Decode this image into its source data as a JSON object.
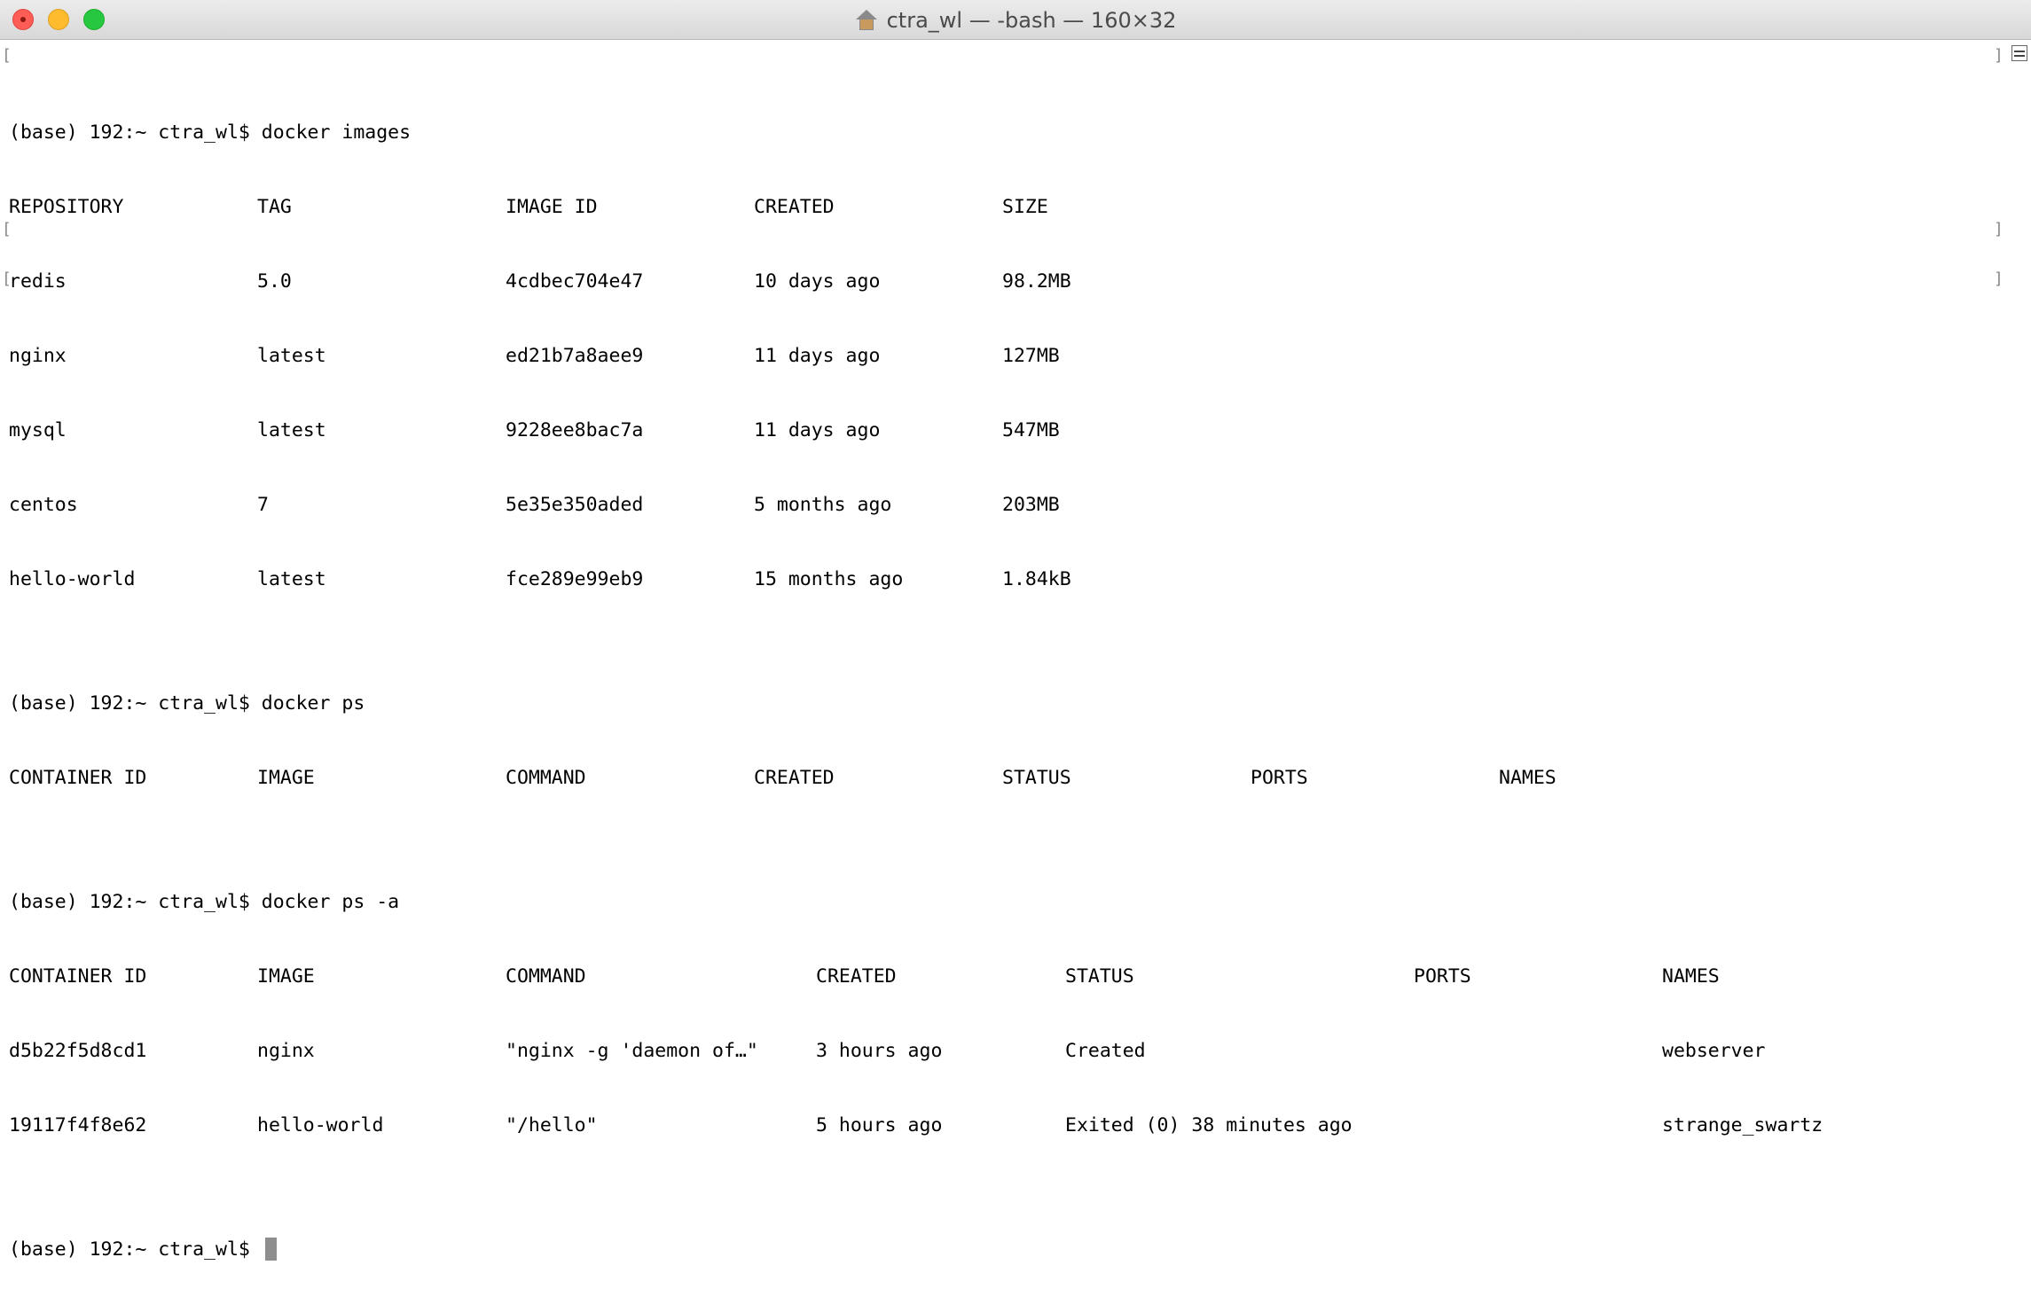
{
  "window": {
    "title": "ctra_wl — -bash — 160×32"
  },
  "terminal": {
    "prompt": "(base) 192:~ ctra_wl$ ",
    "commands": {
      "images": "docker images",
      "ps": "docker ps",
      "ps_a": "docker ps -a"
    },
    "images_table": {
      "headers": [
        "REPOSITORY",
        "TAG",
        "IMAGE ID",
        "CREATED",
        "SIZE"
      ],
      "rows": [
        [
          "redis",
          "5.0",
          "4cdbec704e47",
          "10 days ago",
          "98.2MB"
        ],
        [
          "nginx",
          "latest",
          "ed21b7a8aee9",
          "11 days ago",
          "127MB"
        ],
        [
          "mysql",
          "latest",
          "9228ee8bac7a",
          "11 days ago",
          "547MB"
        ],
        [
          "centos",
          "7",
          "5e35e350aded",
          "5 months ago",
          "203MB"
        ],
        [
          "hello-world",
          "latest",
          "fce289e99eb9",
          "15 months ago",
          "1.84kB"
        ]
      ]
    },
    "ps_table": {
      "headers": [
        "CONTAINER ID",
        "IMAGE",
        "COMMAND",
        "CREATED",
        "STATUS",
        "PORTS",
        "NAMES"
      ]
    },
    "ps_a_table": {
      "headers": [
        "CONTAINER ID",
        "IMAGE",
        "COMMAND",
        "CREATED",
        "STATUS",
        "PORTS",
        "NAMES"
      ],
      "rows": [
        [
          "d5b22f5d8cd1",
          "nginx",
          "\"nginx -g 'daemon of…\"",
          "3 hours ago",
          "Created",
          "",
          "webserver"
        ],
        [
          "19117f4f8e62",
          "hello-world",
          "\"/hello\"",
          "5 hours ago",
          "Exited (0) 38 minutes ago",
          "",
          "strange_swartz"
        ]
      ]
    }
  },
  "colors": {
    "close": "#fd5d55",
    "minimize": "#fdbb2d",
    "maximize": "#27c840",
    "cursor": "#8e8e8e"
  }
}
